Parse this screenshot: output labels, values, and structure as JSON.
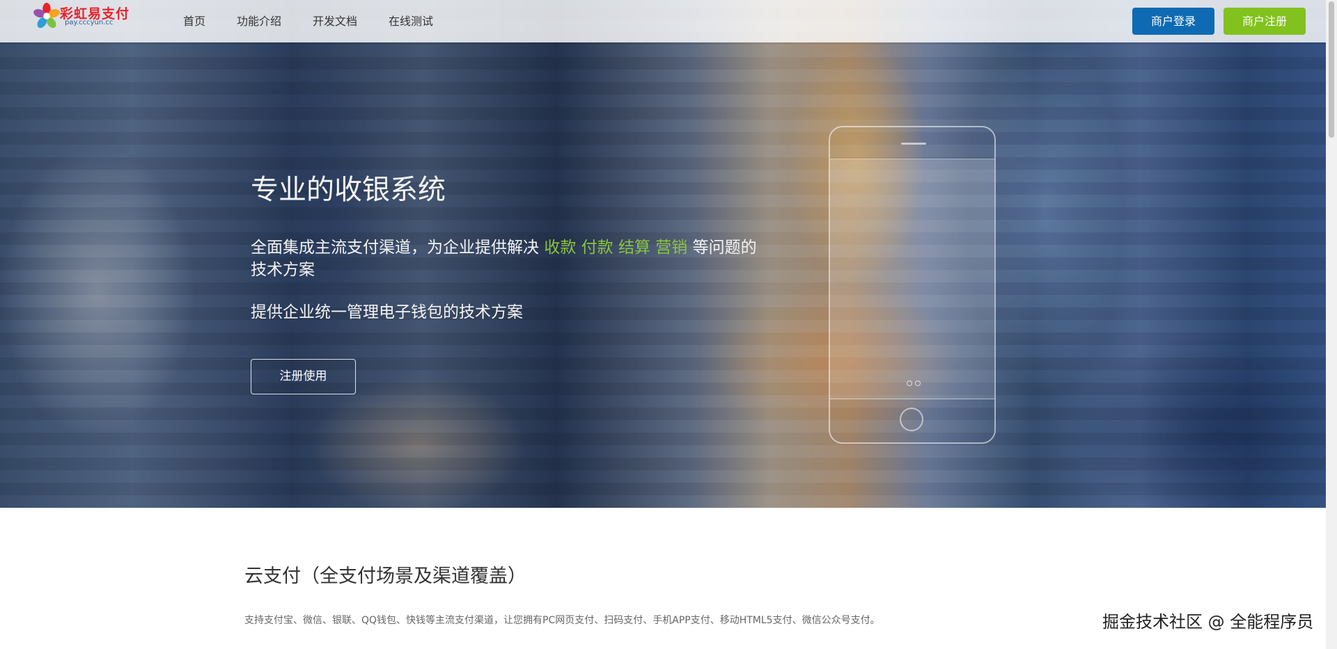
{
  "brand": {
    "logo_text": "彩虹易支付",
    "logo_sub": "pay.cccyun.cc",
    "logo_icon": "rainbow-flower-icon"
  },
  "nav": {
    "links": [
      {
        "label": "首页"
      },
      {
        "label": "功能介绍"
      },
      {
        "label": "开发文档"
      },
      {
        "label": "在线测试"
      }
    ],
    "login_label": "商户登录",
    "register_label": "商户注册"
  },
  "hero": {
    "title": "专业的收银系统",
    "line1_prefix": "全面集成主流支付渠道，为企业提供解决",
    "highlights": [
      "收款",
      "付款",
      "结算",
      "营销"
    ],
    "line1_suffix": "等问题的技术方案",
    "line2": "提供企业统一管理电子钱包的技术方案",
    "cta_label": "注册使用",
    "phone_icon": "phone-mockup-icon"
  },
  "section": {
    "title": "云支付（全支付场景及渠道覆盖）",
    "description": "支持支付宝、微信、银联、QQ钱包、快钱等主流支付渠道，让您拥有PC网页支付、扫码支付、手机APP支付、移动HTML5支付、微信公众号支付。"
  },
  "watermark": "掘金技术社区 @ 全能程序员",
  "colors": {
    "login_button": "#0e6bb3",
    "register_button": "#82c21e",
    "highlight": "#8bc53f"
  }
}
